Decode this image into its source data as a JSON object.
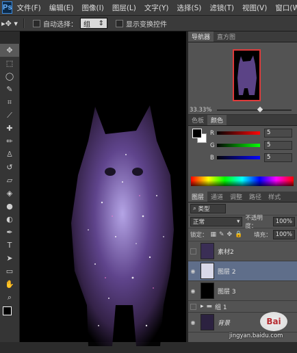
{
  "app": {
    "logo_text": "Ps"
  },
  "menu": [
    "文件(F)",
    "编辑(E)",
    "图像(I)",
    "图层(L)",
    "文字(Y)",
    "选择(S)",
    "滤镜(T)",
    "视图(V)",
    "窗口(W)"
  ],
  "options": {
    "auto_select_label": "自动选择：",
    "auto_select_value": "组",
    "show_transform_label": "显示变换控件"
  },
  "navigator": {
    "tabs": [
      "导航器",
      "直方图"
    ],
    "zoom": "33.33%"
  },
  "color_panel": {
    "tabs": [
      "色板",
      "颜色"
    ],
    "r": {
      "label": "R",
      "value": "5"
    },
    "g": {
      "label": "G",
      "value": "5"
    },
    "b": {
      "label": "B",
      "value": "5"
    }
  },
  "layers_panel": {
    "tabs": [
      "图层",
      "通道",
      "调整",
      "路径",
      "样式"
    ],
    "filter": "类型",
    "blend_mode": "正常",
    "opacity_label": "不透明度：",
    "opacity_value": "100%",
    "lock_label": "锁定：",
    "fill_label": "填充：",
    "fill_value": "100%",
    "layers": [
      {
        "name": "素材2"
      },
      {
        "name": "图层 2"
      },
      {
        "name": "图层 3"
      },
      {
        "name": "组 1"
      },
      {
        "name": "背景"
      }
    ]
  },
  "watermark": {
    "text": "jingyan.baidu.com"
  },
  "colors": {
    "accent": "#5f6e8a",
    "panel": "#535353",
    "dark": "#2b2b2b"
  }
}
